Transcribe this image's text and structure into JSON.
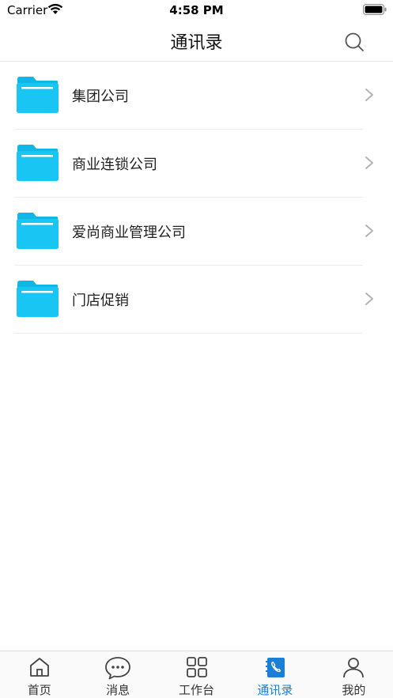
{
  "status_bar": {
    "carrier": "Carrier",
    "time": "4:58 PM"
  },
  "header": {
    "title": "通讯录",
    "search_icon": "search-icon"
  },
  "list": {
    "items": [
      {
        "label": "集团公司",
        "icon": "folder-icon"
      },
      {
        "label": "商业连锁公司",
        "icon": "folder-icon"
      },
      {
        "label": "爱尚商业管理公司",
        "icon": "folder-icon"
      },
      {
        "label": "门店促销",
        "icon": "folder-icon"
      }
    ]
  },
  "tab_bar": {
    "tabs": [
      {
        "label": "首页",
        "icon": "home-icon"
      },
      {
        "label": "消息",
        "icon": "chat-bubble-icon"
      },
      {
        "label": "工作台",
        "icon": "grid-icon"
      },
      {
        "label": "通讯录",
        "icon": "contacts-book-icon",
        "active": true
      },
      {
        "label": "我的",
        "icon": "person-icon"
      }
    ]
  },
  "colors": {
    "accent": "#1a7fd6",
    "folder": "#19c6f3",
    "divider": "#ececec"
  }
}
